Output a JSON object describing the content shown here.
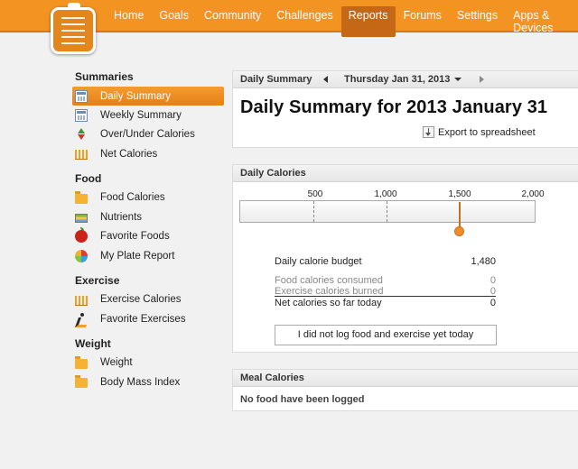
{
  "nav": {
    "items": [
      "Home",
      "Goals",
      "Community",
      "Challenges",
      "Reports",
      "Forums",
      "Settings",
      "Apps & Devices"
    ],
    "active_index": 4
  },
  "sidebar": {
    "sections": [
      {
        "title": "Summaries",
        "items": [
          {
            "label": "Daily Summary",
            "icon": "calendar-grid-icon",
            "active": true
          },
          {
            "label": "Weekly Summary",
            "icon": "calendar-grid-icon"
          },
          {
            "label": "Over/Under Calories",
            "icon": "up-down-arrows-icon"
          },
          {
            "label": "Net Calories",
            "icon": "bar-chart-icon"
          }
        ]
      },
      {
        "title": "Food",
        "items": [
          {
            "label": "Food Calories",
            "icon": "folder-icon"
          },
          {
            "label": "Nutrients",
            "icon": "nutrients-icon"
          },
          {
            "label": "Favorite Foods",
            "icon": "apple-icon"
          },
          {
            "label": "My Plate Report",
            "icon": "pie-chart-icon"
          }
        ]
      },
      {
        "title": "Exercise",
        "items": [
          {
            "label": "Exercise Calories",
            "icon": "bar-chart-icon"
          },
          {
            "label": "Favorite Exercises",
            "icon": "runner-icon"
          }
        ]
      },
      {
        "title": "Weight",
        "items": [
          {
            "label": "Weight",
            "icon": "folder-icon"
          },
          {
            "label": "Body Mass Index",
            "icon": "folder-icon"
          }
        ]
      }
    ]
  },
  "summary": {
    "header": "Daily Summary",
    "date": "Thursday Jan 31, 2013",
    "title": "Daily Summary for 2013 January 31",
    "export_label": "Export to spreadsheet"
  },
  "daily_calories": {
    "header": "Daily Calories",
    "scale_labels": [
      "500",
      "1,000",
      "1,500",
      "2,000"
    ],
    "rows": [
      {
        "label": "Daily calorie budget",
        "value": "1,480"
      },
      {
        "label": "Food calories consumed",
        "value": "0"
      },
      {
        "label": "Exercise calories burned",
        "value": "0"
      },
      {
        "label": "Net calories so far today",
        "value": "0"
      }
    ],
    "button_label": "I did not log food and exercise yet today",
    "accent": "#f29322"
  },
  "meal_calories": {
    "header": "Meal Calories",
    "empty_text": "No food have been logged"
  }
}
